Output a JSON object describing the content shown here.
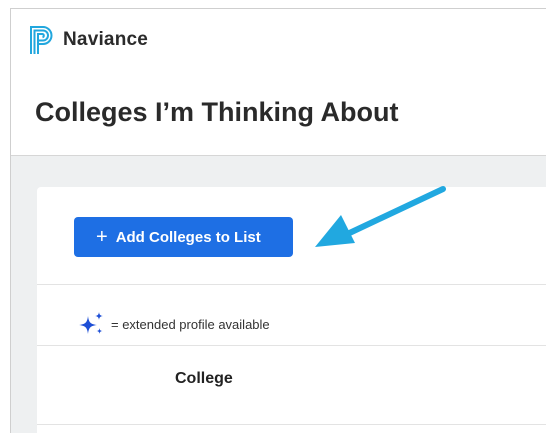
{
  "header": {
    "brand": "Naviance",
    "logo_icon": "naviance-logo-icon"
  },
  "page": {
    "title": "Colleges I’m Thinking About"
  },
  "toolbar": {
    "add_button_icon": "+",
    "add_button_label": "Add Colleges to List"
  },
  "legend": {
    "icon": "sparkle-icon",
    "text": "= extended profile available"
  },
  "table": {
    "columns": [
      "College"
    ]
  },
  "annotation": {
    "arrow_color": "#21a8e0"
  },
  "colors": {
    "brand": "#1e6fe4",
    "logo": "#22a7de",
    "sparkle": "#1e4fd6"
  }
}
